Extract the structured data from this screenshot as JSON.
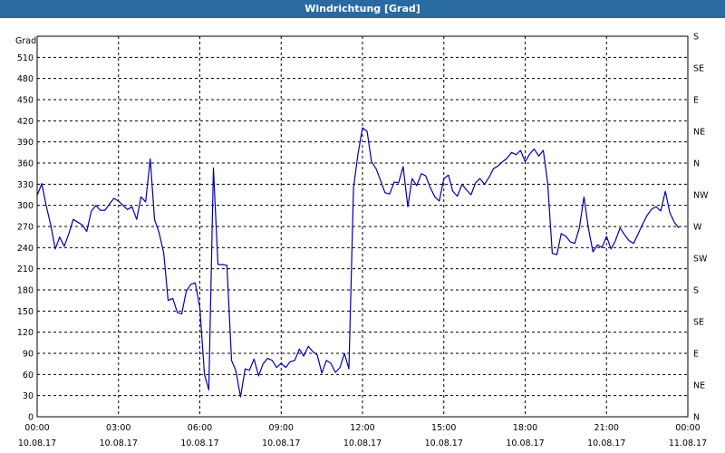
{
  "window": {
    "title": "Windrichtung [Grad]"
  },
  "chart_data": {
    "type": "line",
    "title": "Windrichtung [Grad]",
    "ylabel": "Grad",
    "ylim": [
      0,
      540
    ],
    "y_ticks": [
      0,
      30,
      60,
      90,
      120,
      150,
      180,
      210,
      240,
      270,
      300,
      330,
      360,
      390,
      420,
      450,
      480,
      510
    ],
    "y_right_ticks": [
      {
        "value": 0,
        "label": "N"
      },
      {
        "value": 45,
        "label": "NE"
      },
      {
        "value": 90,
        "label": "E"
      },
      {
        "value": 135,
        "label": "SE"
      },
      {
        "value": 180,
        "label": "S"
      },
      {
        "value": 225,
        "label": "SW"
      },
      {
        "value": 270,
        "label": "W"
      },
      {
        "value": 315,
        "label": "NW"
      },
      {
        "value": 360,
        "label": "N"
      },
      {
        "value": 405,
        "label": "NE"
      },
      {
        "value": 450,
        "label": "E"
      },
      {
        "value": 495,
        "label": "SE"
      },
      {
        "value": 540,
        "label": "S"
      }
    ],
    "xlim": [
      0,
      24
    ],
    "x_ticks": [
      {
        "hour": 0,
        "time": "00:00",
        "date": "10.08.17"
      },
      {
        "hour": 3,
        "time": "03:00",
        "date": "10.08.17"
      },
      {
        "hour": 6,
        "time": "06:00",
        "date": "10.08.17"
      },
      {
        "hour": 9,
        "time": "09:00",
        "date": "10.08.17"
      },
      {
        "hour": 12,
        "time": "12:00",
        "date": "10.08.17"
      },
      {
        "hour": 15,
        "time": "15:00",
        "date": "10.08.17"
      },
      {
        "hour": 18,
        "time": "18:00",
        "date": "10.08.17"
      },
      {
        "hour": 21,
        "time": "21:00",
        "date": "10.08.17"
      },
      {
        "hour": 24,
        "time": "00:00",
        "date": "11.08.17"
      }
    ],
    "grid": true,
    "series": [
      {
        "color": "#0000aa",
        "points": [
          [
            0.0,
            314
          ],
          [
            0.17,
            331
          ],
          [
            0.33,
            300
          ],
          [
            0.5,
            272
          ],
          [
            0.67,
            238
          ],
          [
            0.83,
            255
          ],
          [
            1.0,
            242
          ],
          [
            1.17,
            260
          ],
          [
            1.33,
            280
          ],
          [
            1.5,
            276
          ],
          [
            1.67,
            272
          ],
          [
            1.83,
            263
          ],
          [
            2.0,
            292
          ],
          [
            2.17,
            300
          ],
          [
            2.33,
            293
          ],
          [
            2.5,
            293
          ],
          [
            2.67,
            302
          ],
          [
            2.83,
            310
          ],
          [
            3.0,
            306
          ],
          [
            3.17,
            300
          ],
          [
            3.33,
            294
          ],
          [
            3.5,
            298
          ],
          [
            3.67,
            280
          ],
          [
            3.83,
            312
          ],
          [
            4.0,
            305
          ],
          [
            4.17,
            366
          ],
          [
            4.33,
            280
          ],
          [
            4.5,
            261
          ],
          [
            4.67,
            232
          ],
          [
            4.83,
            165
          ],
          [
            5.0,
            168
          ],
          [
            5.17,
            148
          ],
          [
            5.33,
            146
          ],
          [
            5.5,
            178
          ],
          [
            5.67,
            188
          ],
          [
            5.83,
            190
          ],
          [
            6.0,
            155
          ],
          [
            6.17,
            60
          ],
          [
            6.33,
            38
          ],
          [
            6.5,
            353
          ],
          [
            6.67,
            216
          ],
          [
            6.83,
            216
          ],
          [
            7.0,
            215
          ],
          [
            7.17,
            80
          ],
          [
            7.33,
            65
          ],
          [
            7.5,
            28
          ],
          [
            7.67,
            68
          ],
          [
            7.83,
            66
          ],
          [
            8.0,
            82
          ],
          [
            8.17,
            58
          ],
          [
            8.33,
            75
          ],
          [
            8.5,
            83
          ],
          [
            8.67,
            80
          ],
          [
            8.83,
            70
          ],
          [
            9.0,
            76
          ],
          [
            9.17,
            70
          ],
          [
            9.33,
            78
          ],
          [
            9.5,
            80
          ],
          [
            9.67,
            96
          ],
          [
            9.83,
            86
          ],
          [
            10.0,
            100
          ],
          [
            10.17,
            92
          ],
          [
            10.33,
            88
          ],
          [
            10.5,
            62
          ],
          [
            10.67,
            80
          ],
          [
            10.83,
            76
          ],
          [
            11.0,
            63
          ],
          [
            11.17,
            70
          ],
          [
            11.33,
            90
          ],
          [
            11.5,
            68
          ],
          [
            11.67,
            325
          ],
          [
            11.83,
            372
          ],
          [
            12.0,
            410
          ],
          [
            12.17,
            405
          ],
          [
            12.33,
            362
          ],
          [
            12.5,
            352
          ],
          [
            12.67,
            335
          ],
          [
            12.83,
            318
          ],
          [
            13.0,
            316
          ],
          [
            13.17,
            333
          ],
          [
            13.33,
            332
          ],
          [
            13.5,
            355
          ],
          [
            13.67,
            298
          ],
          [
            13.83,
            338
          ],
          [
            14.0,
            328
          ],
          [
            14.17,
            345
          ],
          [
            14.33,
            342
          ],
          [
            14.5,
            325
          ],
          [
            14.67,
            312
          ],
          [
            14.83,
            306
          ],
          [
            15.0,
            338
          ],
          [
            15.17,
            343
          ],
          [
            15.33,
            320
          ],
          [
            15.5,
            313
          ],
          [
            15.67,
            330
          ],
          [
            15.83,
            322
          ],
          [
            16.0,
            315
          ],
          [
            16.17,
            332
          ],
          [
            16.33,
            338
          ],
          [
            16.5,
            330
          ],
          [
            16.67,
            340
          ],
          [
            16.83,
            352
          ],
          [
            17.0,
            356
          ],
          [
            17.17,
            362
          ],
          [
            17.33,
            367
          ],
          [
            17.5,
            375
          ],
          [
            17.67,
            372
          ],
          [
            17.83,
            378
          ],
          [
            18.0,
            362
          ],
          [
            18.17,
            373
          ],
          [
            18.33,
            380
          ],
          [
            18.5,
            370
          ],
          [
            18.67,
            378
          ],
          [
            18.83,
            332
          ],
          [
            19.0,
            232
          ],
          [
            19.17,
            230
          ],
          [
            19.33,
            260
          ],
          [
            19.5,
            256
          ],
          [
            19.67,
            248
          ],
          [
            19.83,
            246
          ],
          [
            20.0,
            268
          ],
          [
            20.17,
            312
          ],
          [
            20.33,
            268
          ],
          [
            20.5,
            234
          ],
          [
            20.67,
            244
          ],
          [
            20.83,
            240
          ],
          [
            21.0,
            256
          ],
          [
            21.17,
            238
          ],
          [
            21.33,
            250
          ],
          [
            21.5,
            268
          ],
          [
            21.67,
            258
          ],
          [
            21.83,
            250
          ],
          [
            22.0,
            246
          ],
          [
            22.17,
            260
          ],
          [
            22.33,
            273
          ],
          [
            22.5,
            286
          ],
          [
            22.67,
            295
          ],
          [
            22.83,
            298
          ],
          [
            23.0,
            292
          ],
          [
            23.17,
            320
          ],
          [
            23.33,
            290
          ],
          [
            23.5,
            276
          ],
          [
            23.67,
            268
          ]
        ]
      }
    ]
  }
}
